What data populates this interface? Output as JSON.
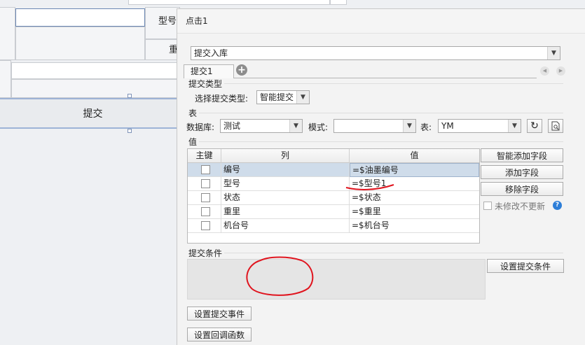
{
  "background": {
    "label_model": "型号",
    "label_weight": "重",
    "submit_label": "提交"
  },
  "dialog": {
    "title": "点击1",
    "action_type": "提交入库",
    "tabs": [
      {
        "label": "提交1"
      }
    ],
    "submit_type": {
      "section_label": "提交类型",
      "field_label": "选择提交类型:",
      "value": "智能提交"
    },
    "table_section": {
      "section_label": "表",
      "database_label": "数据库:",
      "database_value": "测试",
      "schema_label": "模式:",
      "schema_value": "",
      "table_label": "表:",
      "table_value": "YM"
    },
    "value_section": {
      "section_label": "值",
      "columns": [
        "主键",
        "列",
        "值"
      ],
      "rows": [
        {
          "column": "编号",
          "value": "=$油墨编号",
          "selected": true
        },
        {
          "column": "型号",
          "value": "=$型号1",
          "selected": false
        },
        {
          "column": "状态",
          "value": "=$状态",
          "selected": false
        },
        {
          "column": "重里",
          "value": "=$重里",
          "selected": false
        },
        {
          "column": "机台号",
          "value": "=$机台号",
          "selected": false
        }
      ],
      "buttons": {
        "smart_add": "智能添加字段",
        "add": "添加字段",
        "remove": "移除字段"
      },
      "unchanged_no_update": "未修改不更新"
    },
    "condition_section": {
      "section_label": "提交条件",
      "set_condition": "设置提交条件"
    },
    "set_event": "设置提交事件",
    "set_callback": "设置回调函数"
  },
  "colors": {
    "selected_row": "#cfdcea",
    "annotation": "#e0141e",
    "help_icon": "#2d7ed8"
  }
}
